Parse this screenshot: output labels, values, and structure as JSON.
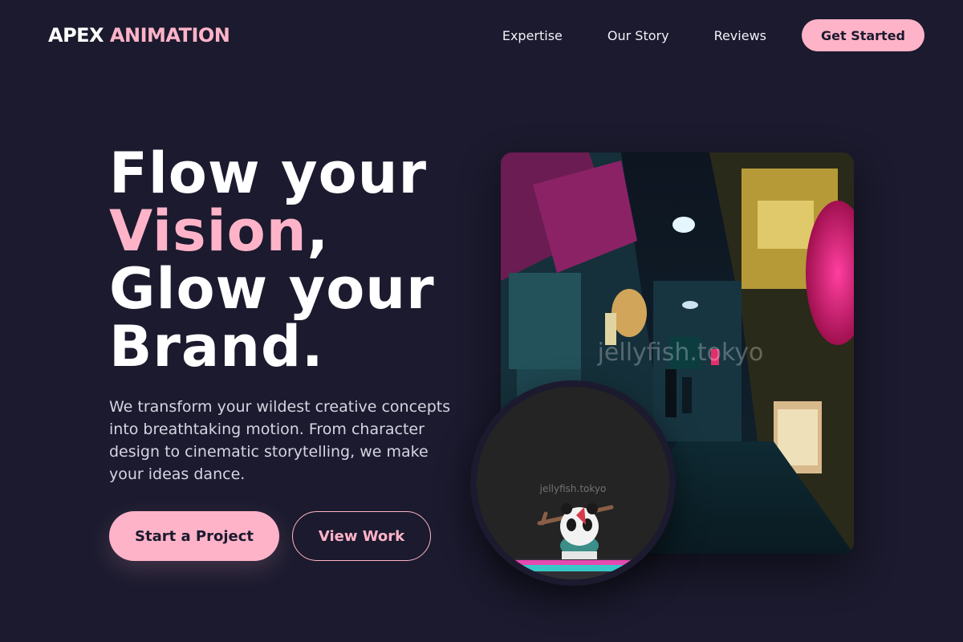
{
  "header": {
    "logo_primary": "APEX",
    "logo_accent": "ANIMATION",
    "nav": [
      {
        "label": "Expertise"
      },
      {
        "label": "Our Story"
      },
      {
        "label": "Reviews"
      }
    ],
    "cta_label": "Get Started"
  },
  "hero": {
    "title_line1": "Flow your",
    "title_accent": "Vision",
    "title_comma": ",",
    "title_line3": "Glow your",
    "title_line4": "Brand.",
    "description": "We transform your wildest creative concepts into breathtaking motion. From character design to cinematic storytelling, we make your ideas dance.",
    "primary_button": "Start a Project",
    "secondary_button": "View Work"
  },
  "media": {
    "main_watermark": "jellyfish.tokyo",
    "circle_watermark": "jellyfish.tokyo"
  },
  "colors": {
    "background": "#1b1a2e",
    "accent": "#ffb3c8",
    "text": "#ffffff",
    "muted_text": "#d7d4e2"
  }
}
